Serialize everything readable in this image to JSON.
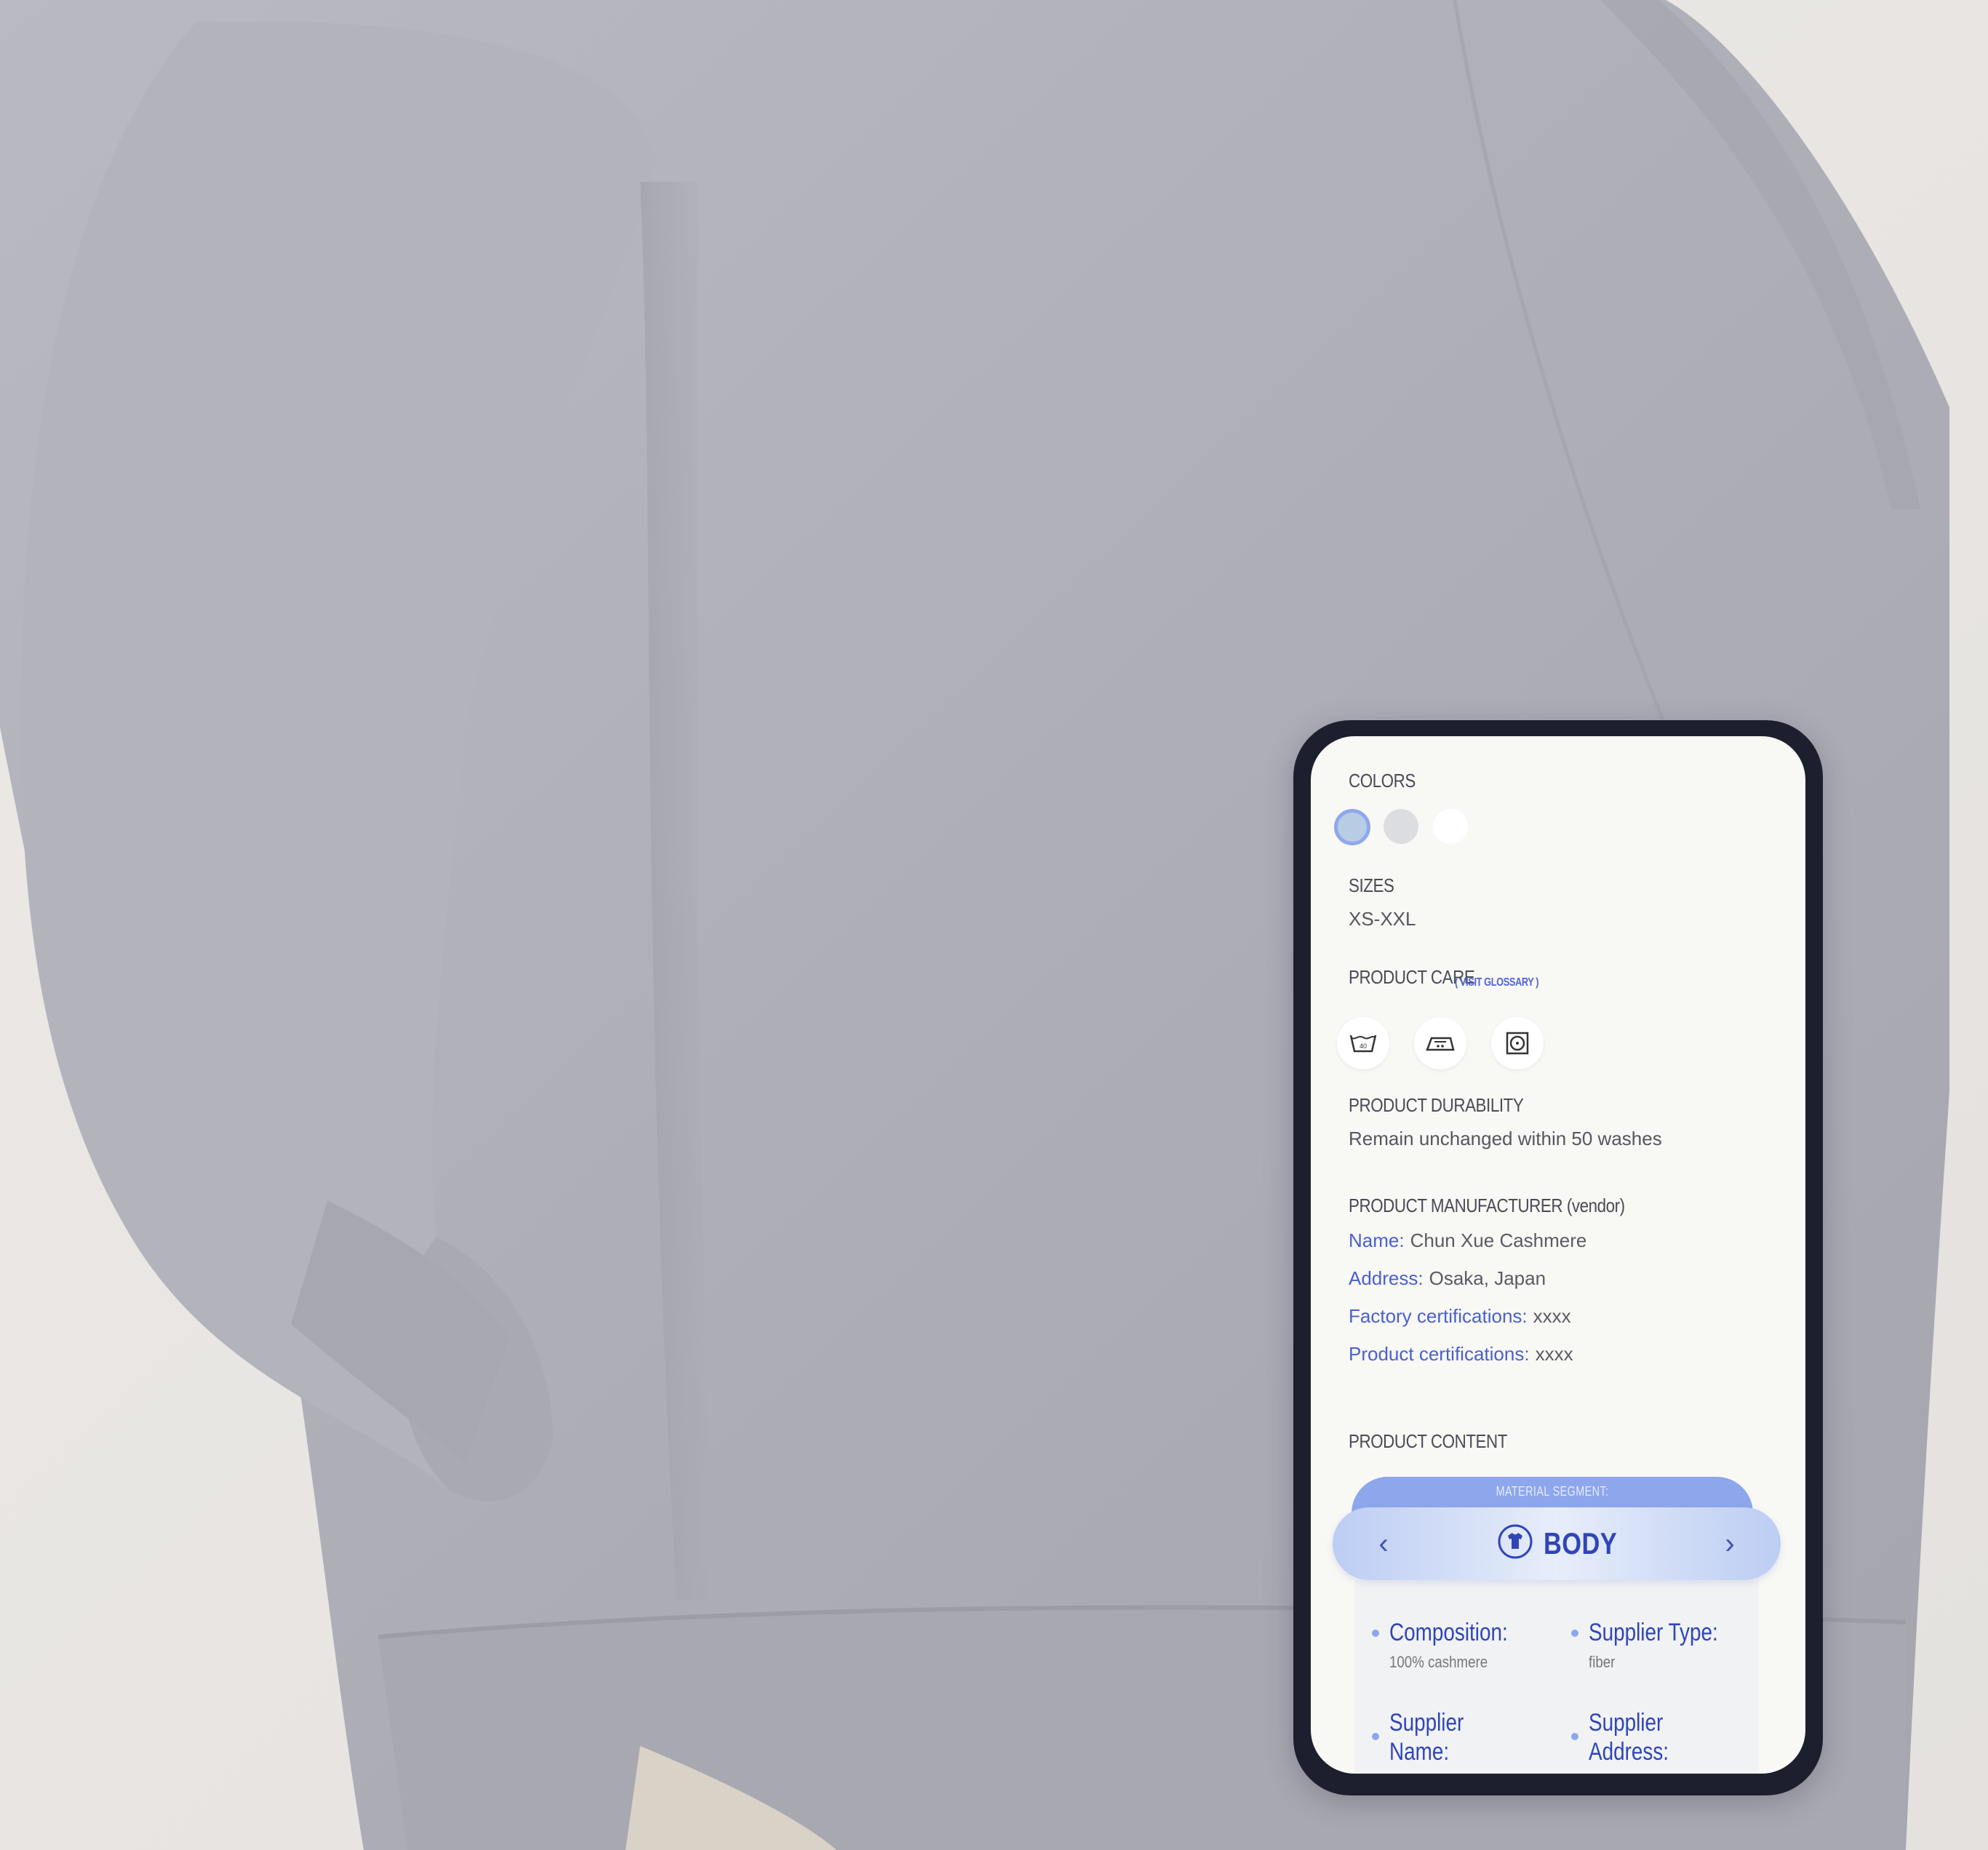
{
  "colors": {
    "title": "COLORS",
    "swatches": [
      "#b8cde4",
      "#dcdde0",
      "#ffffff"
    ],
    "selected_index": 0
  },
  "sizes": {
    "title": "SIZES",
    "value": "XS-XXL"
  },
  "care": {
    "title": "PRODUCT CARE",
    "glossary_link": "( VISIT GLOSSARY )",
    "icons": [
      "wash-40-icon",
      "iron-icon",
      "tumble-dry-icon"
    ]
  },
  "durability": {
    "title": "PRODUCT DURABILITY",
    "value": "Remain unchanged within 50 washes"
  },
  "manufacturer": {
    "title": "PRODUCT MANUFACTURER (vendor)",
    "fields": [
      {
        "key": "Name:",
        "value": "Chun Xue Cashmere"
      },
      {
        "key": "Address:",
        "value": "Osaka, Japan"
      },
      {
        "key": "Factory certifications:",
        "value": "xxxx"
      },
      {
        "key": "Product certifications:",
        "value": "xxxx"
      }
    ]
  },
  "content": {
    "title": "PRODUCT CONTENT",
    "segment_caption": "MATERIAL SEGMENT:",
    "segment_name": "BODY",
    "attributes": [
      {
        "label": "Composition:",
        "value": "100% cashmere"
      },
      {
        "label": "Supplier Type:",
        "value": "fiber"
      },
      {
        "label": "Supplier Name:",
        "value": ""
      },
      {
        "label": "Supplier Address:",
        "value": ""
      }
    ]
  },
  "theme": {
    "accent": "#4a5fd0",
    "segment": "#8da6ec",
    "phone_frame": "#1d1f2e"
  }
}
